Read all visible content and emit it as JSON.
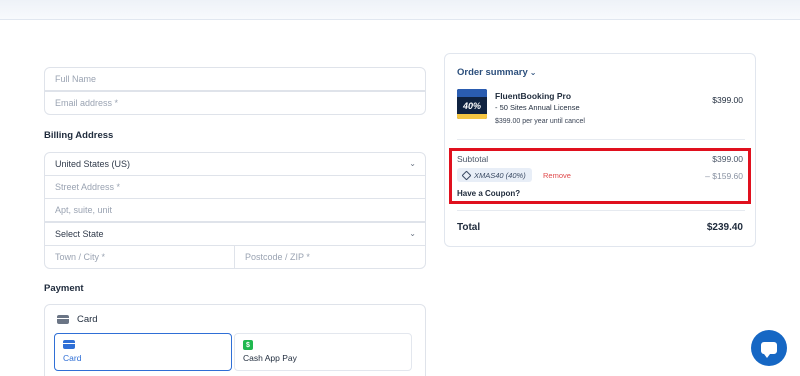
{
  "contact": {
    "full_name_placeholder": "Full Name",
    "email_placeholder": "Email address *"
  },
  "billing": {
    "title": "Billing Address",
    "country_value": "United States (US)",
    "street_placeholder": "Street Address *",
    "apt_placeholder": "Apt, suite, unit",
    "state_value": "Select State",
    "city_placeholder": "Town / City *",
    "postcode_placeholder": "Postcode / ZIP *"
  },
  "payment": {
    "title": "Payment",
    "method_label": "Card",
    "options": [
      {
        "label": "Card",
        "icon": "card-icon",
        "selected": true
      },
      {
        "label": "Cash App Pay",
        "icon": "cash-app-icon",
        "selected": false
      }
    ]
  },
  "summary": {
    "title": "Order summary",
    "product": {
      "name": "FluentBooking Pro",
      "variant": "- 50 Sites Annual License",
      "recurrence": "$399.00 per year until cancel",
      "price": "$399.00",
      "thumb_text": "40%"
    },
    "subtotal_label": "Subtotal",
    "subtotal_value": "$399.00",
    "coupon_code": "XMAS40 (40%)",
    "remove_label": "Remove",
    "discount_value": "– $159.60",
    "have_coupon": "Have a Coupon?",
    "total_label": "Total",
    "total_value": "$239.40"
  },
  "colors": {
    "accent": "#2f6fd6",
    "highlight": "#e0101e",
    "remove": "#e0494b",
    "chat": "#1667c4"
  }
}
